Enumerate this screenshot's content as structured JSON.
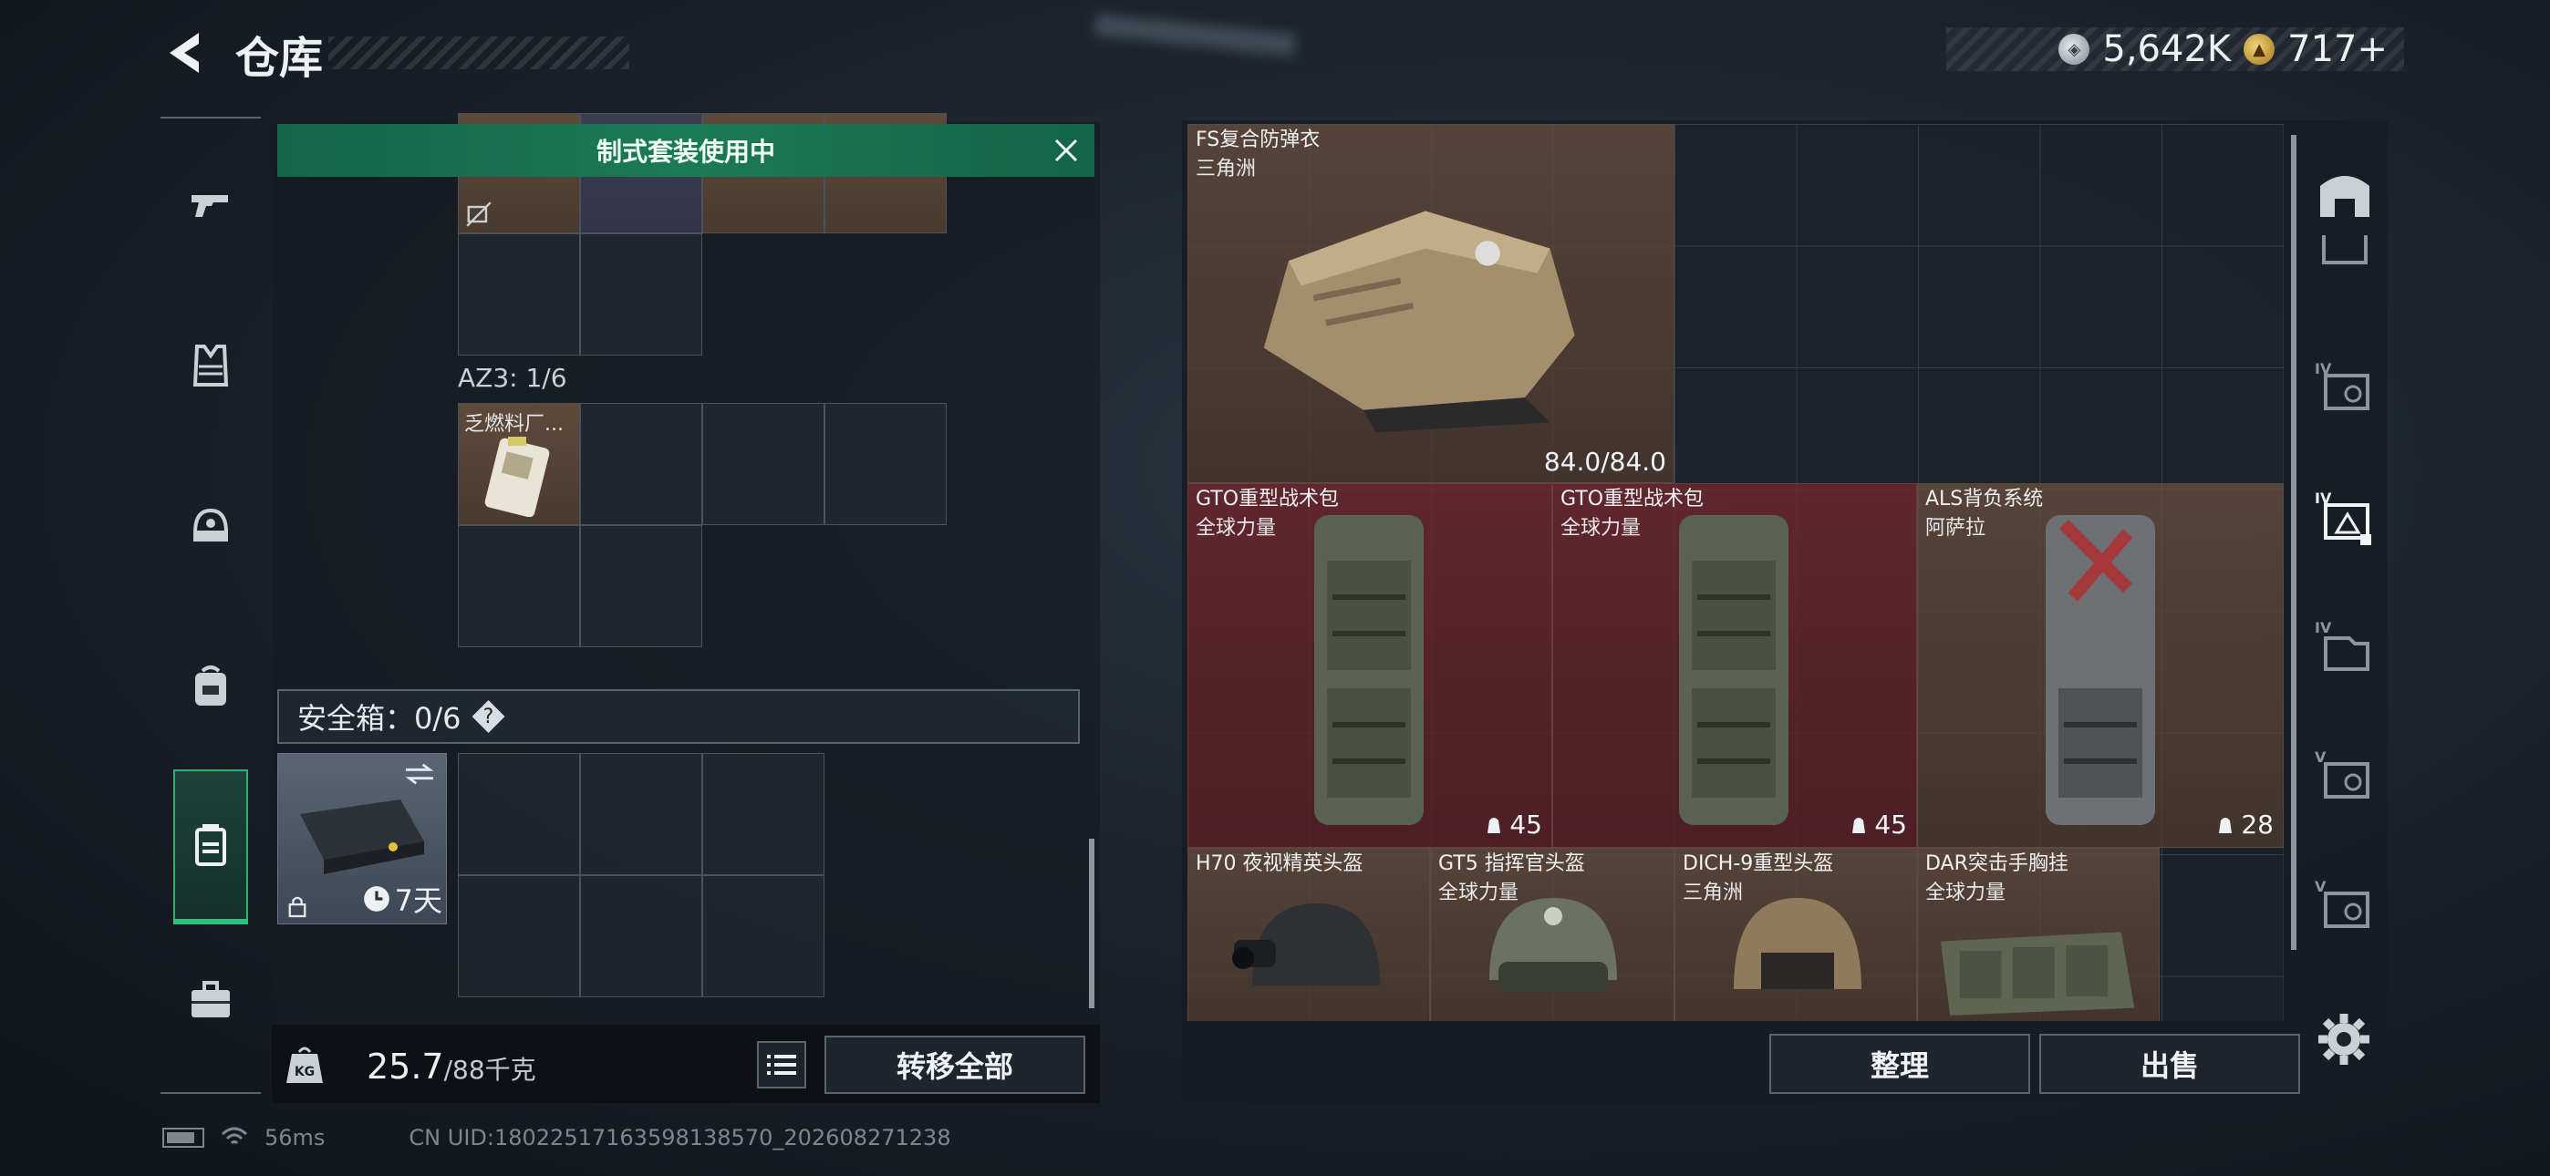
{
  "header": {
    "title": "仓库",
    "currencies": [
      {
        "icon": "silver-coin-icon",
        "value": "5,642K"
      },
      {
        "icon": "gold-coin-icon",
        "value": "717+"
      }
    ]
  },
  "categories": [
    {
      "name": "pistol-icon",
      "active": false
    },
    {
      "name": "vest-icon",
      "active": false
    },
    {
      "name": "helmet-icon",
      "active": false
    },
    {
      "name": "backpack-icon",
      "active": false
    },
    {
      "name": "rig-icon",
      "active": true
    },
    {
      "name": "briefcase-icon",
      "active": false
    }
  ],
  "left_panel": {
    "kit_banner": "制式套装使用中",
    "az3_label": "AZ3: 1/6",
    "az3_item_name": "乏燃料厂...",
    "safe_box_label": "安全箱：0/6",
    "help_symbol": "?",
    "safe_item_timer": "7天",
    "weight_current": "25.7",
    "weight_capacity": "/88千克",
    "transfer_all_label": "转移全部"
  },
  "stash": {
    "items": [
      {
        "name": "FS复合防弹衣",
        "sub": "三角洲",
        "durability": "84.0/84.0",
        "color": "brown"
      },
      {
        "name": "GTO重型战术包",
        "sub": "全球力量",
        "capacity": "45",
        "color": "red"
      },
      {
        "name": "GTO重型战术包",
        "sub": "全球力量",
        "capacity": "45",
        "color": "red"
      },
      {
        "name": "ALS背负系统",
        "sub": "阿萨拉",
        "capacity": "28",
        "color": "brown"
      },
      {
        "name": "H70 夜视精英头盔",
        "sub": "",
        "color": "brown"
      },
      {
        "name": "GT5 指挥官头盔",
        "sub": "全球力量",
        "color": "brown"
      },
      {
        "name": "DICH-9重型头盔",
        "sub": "三角洲",
        "color": "brown"
      },
      {
        "name": "DAR突击手胸挂",
        "sub": "全球力量",
        "color": "brown"
      }
    ],
    "sort_label": "整理",
    "sell_label": "出售"
  },
  "right_tabs": [
    {
      "name": "armory-tab-icon"
    },
    {
      "name": "tier-4-tab-icon",
      "tier": "IV"
    },
    {
      "name": "tier-4-selected-tab-icon",
      "tier": "IV"
    },
    {
      "name": "tier-4-box-tab-icon",
      "tier": "IV"
    },
    {
      "name": "tier-5-tab-icon",
      "tier": "V"
    },
    {
      "name": "tier-5-box-tab-icon",
      "tier": "V"
    }
  ],
  "status": {
    "ping": "56ms",
    "uid": "CN UID:18022517163598138570_202608271238"
  },
  "colors": {
    "accent_green": "#1b7a57",
    "red_slot": "#70282e",
    "brown_slot": "#6a4e3e"
  }
}
